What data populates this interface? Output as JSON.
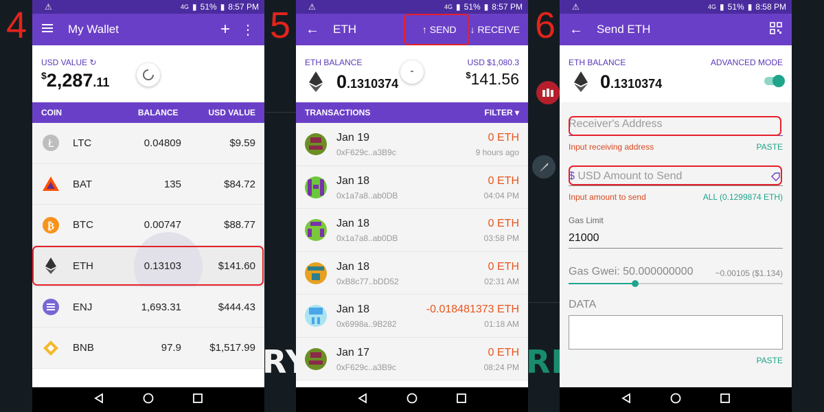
{
  "steps": [
    "4",
    "5",
    "6"
  ],
  "status": {
    "battery": "51%",
    "time_a": "8:57 PM",
    "time_b": "8:57 PM",
    "time_c": "8:58 PM",
    "net": "4G"
  },
  "background_text": {
    "left": "RY",
    "right": "RE"
  },
  "screen4": {
    "title": "My Wallet",
    "usd_value_label": "USD VALUE",
    "usd_value_dollar": "$",
    "usd_value_main": "2,287",
    "usd_value_cents": ".11",
    "columns": {
      "coin": "COIN",
      "balance": "BALANCE",
      "usd": "USD VALUE"
    },
    "coins": [
      {
        "name": "LTC",
        "balance": "0.04809",
        "usd": "$9.59"
      },
      {
        "name": "BAT",
        "balance": "135",
        "usd": "$84.72"
      },
      {
        "name": "BTC",
        "balance": "0.00747",
        "usd": "$88.77"
      },
      {
        "name": "ETH",
        "balance": "0.13103",
        "usd": "$141.60"
      },
      {
        "name": "ENJ",
        "balance": "1,693.31",
        "usd": "$444.43"
      },
      {
        "name": "BNB",
        "balance": "97.9",
        "usd": "$1,517.99"
      }
    ]
  },
  "screen5": {
    "title": "ETH",
    "send": "SEND",
    "receive": "RECEIVE",
    "eth_balance_label": "ETH BALANCE",
    "eth_balance_int": "0",
    "eth_balance_dec": ".1310374",
    "usd_rate": "USD $1,080.3",
    "usd_dollar": "$",
    "usd_value": "141.56",
    "minus": "-",
    "transactions_label": "TRANSACTIONS",
    "filter": "FILTER",
    "transactions": [
      {
        "date": "Jan 19",
        "addr": "0xF629c..a3B9c",
        "amount": "0 ETH",
        "time": "9 hours ago",
        "colors": [
          "#6b8e23",
          "#8b2a4a"
        ]
      },
      {
        "date": "Jan 18",
        "addr": "0x1a7a8..ab0DB",
        "amount": "0 ETH",
        "time": "04:04 PM",
        "colors": [
          "#6bc83a",
          "#7a32a8"
        ]
      },
      {
        "date": "Jan 18",
        "addr": "0x1a7a8..ab0DB",
        "amount": "0 ETH",
        "time": "03:58 PM",
        "colors": [
          "#7bc83a",
          "#7a32a8"
        ]
      },
      {
        "date": "Jan 18",
        "addr": "0xB8c77..bDD52",
        "amount": "0 ETH",
        "time": "02:31 AM",
        "colors": [
          "#e8a020",
          "#2f7f8a"
        ]
      },
      {
        "date": "Jan 18",
        "addr": "0x6998a..9B282",
        "amount": "-0.018481373 ETH",
        "time": "01:18 AM",
        "colors": [
          "#4aa6e8",
          "#a8e4f2"
        ]
      },
      {
        "date": "Jan 17",
        "addr": "0xF629c..a3B9c",
        "amount": "0 ETH",
        "time": "08:24 PM",
        "colors": [
          "#6b8e23",
          "#8b2a4a"
        ]
      }
    ]
  },
  "screen6": {
    "title": "Send ETH",
    "eth_balance_label": "ETH BALANCE",
    "eth_balance_int": "0",
    "eth_balance_dec": ".1310374",
    "advanced_mode": "ADVANCED MODE",
    "advanced_mode_on": true,
    "receiver_placeholder": "Receiver's Address",
    "receiver_hint": "Input receiving address",
    "paste": "PASTE",
    "amount_dollar": "$",
    "amount_placeholder": "USD Amount to Send",
    "amount_hint": "Input amount to send",
    "all_label": "ALL (0.1299874 ETH)",
    "gas_limit_label": "Gas Limit",
    "gas_limit_value": "21000",
    "gas_gwei_label": "Gas Gwei: 50.000000000",
    "gas_fee": "~0.00105 ($1.134)",
    "gas_slider_fraction": 0.31,
    "data_label": "DATA",
    "paste2": "PASTE"
  },
  "colors": {
    "header": "#6a3fc7",
    "status": "#4b2c9f",
    "accent_red": "#e5202a",
    "teal": "#1ea58c",
    "orange": "#e8541b"
  }
}
